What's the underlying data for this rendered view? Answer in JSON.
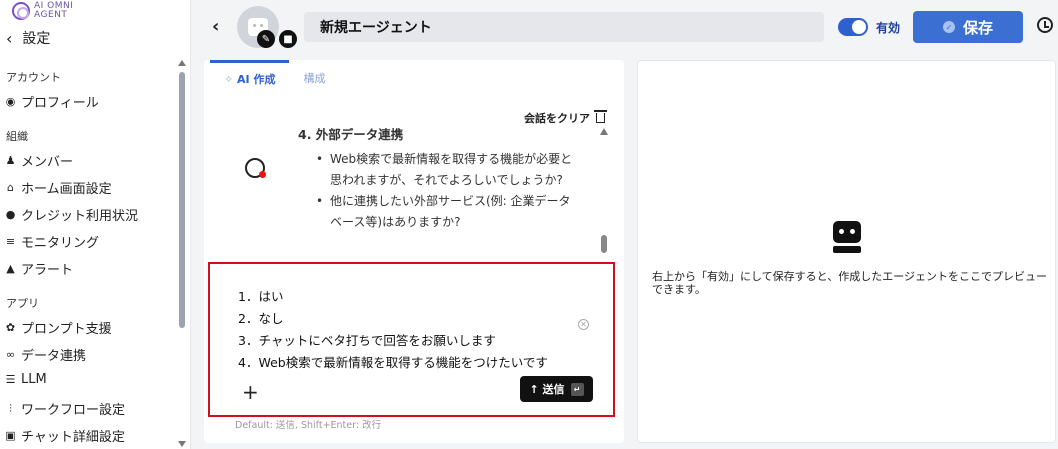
{
  "logo": {
    "line1": "AI OMNI",
    "line2": "AGENT"
  },
  "sidebar": {
    "back_label": "設定",
    "sections": [
      {
        "label": "アカウント"
      },
      {
        "label": "組織"
      },
      {
        "label": "アプリ"
      }
    ],
    "items": [
      {
        "label": "プロフィール",
        "icon": "user-circle-icon"
      },
      {
        "label": "メンバー",
        "icon": "users-icon"
      },
      {
        "label": "ホーム画面設定",
        "icon": "home-icon"
      },
      {
        "label": "クレジット利用状況",
        "icon": "credit-icon"
      },
      {
        "label": "モニタリング",
        "icon": "database-icon"
      },
      {
        "label": "アラート",
        "icon": "bell-icon"
      },
      {
        "label": "プロンプト支援",
        "icon": "brain-icon"
      },
      {
        "label": "データ連携",
        "icon": "link-icon"
      },
      {
        "label": "LLM",
        "icon": "server-icon"
      },
      {
        "label": "ワークフロー設定",
        "icon": "workflow-icon"
      },
      {
        "label": "チャット詳細設定",
        "icon": "chat-icon"
      }
    ]
  },
  "header": {
    "agent_name": "新規エージェント",
    "toggle_label": "有効",
    "toggle_on": true,
    "save_label": "保存"
  },
  "tabs": [
    {
      "label": "AI 作成",
      "active": true
    },
    {
      "label": "構成",
      "active": false
    }
  ],
  "chat": {
    "clear_label": "会話をクリア",
    "heading": "4. 外部データ連携",
    "bullets": [
      "Web検索で最新情報を取得する機能が必要と思われますが、それでよろしいでしょうか?",
      "他に連携したい外部サービス(例: 企業データベース等)はありますか?"
    ]
  },
  "input": {
    "lines": [
      "1．はい",
      "2．なし",
      "3．チャットにベタ打ちで回答をお願いします",
      "4．Web検索で最新情報を取得する機能をつけたいです"
    ],
    "send_label": "送信",
    "hint": "Default: 送信, Shift+Enter: 改行"
  },
  "preview": {
    "message": "右上から「有効」にして保存すると、作成したエージェントをここでプレビューできます。"
  },
  "colors": {
    "accent": "#3b6fd1",
    "highlight_border": "#d0101a"
  }
}
